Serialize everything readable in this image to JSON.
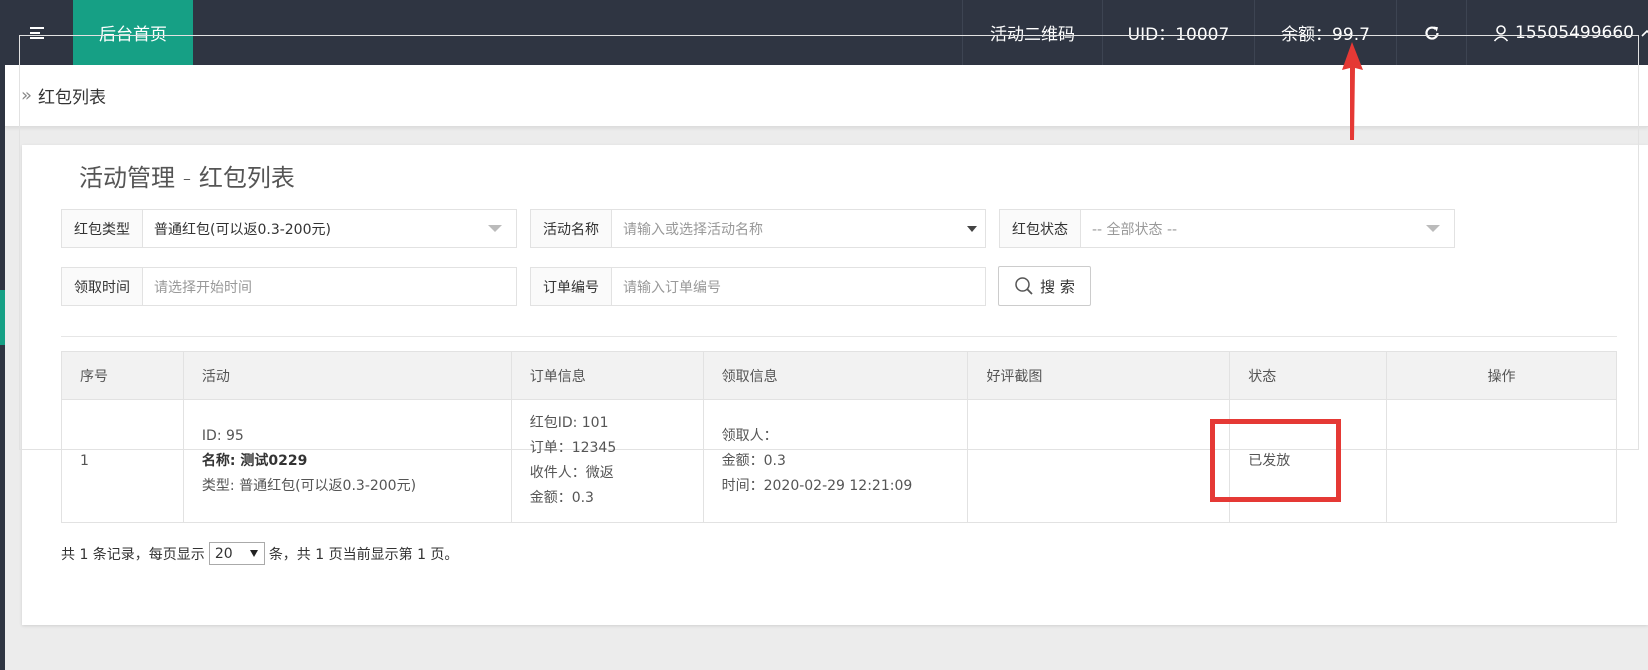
{
  "topbar": {
    "home_label": "后台首页",
    "qr_label": "活动二维码",
    "uid_text": "UID：10007",
    "balance_text": "余额：99.7",
    "user_phone": "15505499660"
  },
  "breadcrumb": {
    "label": "红包列表"
  },
  "panel": {
    "legend": "活动管理 - 红包列表"
  },
  "filters": {
    "type": {
      "label": "红包类型",
      "value": "普通红包(可以返0.3-200元)"
    },
    "activity": {
      "label": "活动名称",
      "placeholder": "请输入或选择活动名称"
    },
    "status": {
      "label": "红包状态",
      "placeholder": "-- 全部状态 --"
    },
    "time": {
      "label": "领取时间",
      "placeholder": "请选择开始时间"
    },
    "order": {
      "label": "订单编号",
      "placeholder": "请输入订单编号"
    },
    "search_label": "搜 索"
  },
  "table": {
    "headers": [
      "序号",
      "活动",
      "订单信息",
      "领取信息",
      "好评截图",
      "状态",
      "操作"
    ],
    "rows": [
      {
        "index": "1",
        "activity": {
          "id": "ID: 95",
          "name": "名称: 测试0229",
          "type": "类型: 普通红包(可以返0.3-200元)"
        },
        "order": {
          "hb_id": "红包ID: 101",
          "order_no": "订单：12345",
          "receiver": "收件人：微返",
          "amount": "金额：0.3"
        },
        "receive": {
          "person": "领取人：",
          "amount": "金额：0.3",
          "time": "时间：2020-02-29 12:21:09"
        },
        "screenshot": "",
        "status": "已发放",
        "actions": ""
      }
    ]
  },
  "pager": {
    "prefix": "共 1 条记录，每页显示",
    "page_size": "20",
    "suffix": "条，共 1 页当前显示第 1 页。"
  },
  "colors": {
    "topbar": "#2f3542",
    "accent": "#16a085",
    "annotation": "#e53935"
  },
  "icons": [
    "menu-icon",
    "refresh-icon",
    "user-icon",
    "chevron-up-icon",
    "search-icon"
  ]
}
